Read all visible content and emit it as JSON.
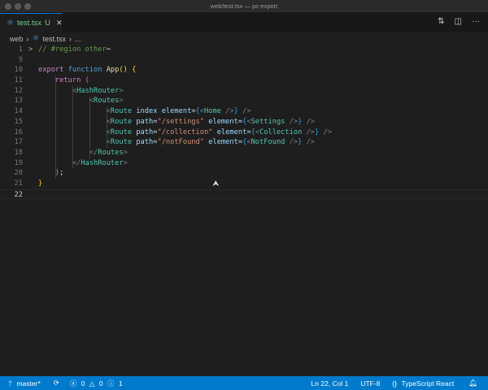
{
  "window": {
    "title": "web/test.tsx — ps-export"
  },
  "tab": {
    "name": "test.tsx",
    "status": "U",
    "close": "✕"
  },
  "breadcrumb": {
    "folder": "web",
    "file": "test.tsx",
    "more": "..."
  },
  "toolbar": {
    "compare": "⇅",
    "split": "◫",
    "more": "···"
  },
  "editor": {
    "lines": [
      {
        "n": "1",
        "fold": ">",
        "tokens": [
          [
            "// #region other",
            "cm"
          ],
          [
            "⋯",
            "pl"
          ]
        ]
      },
      {
        "n": "9",
        "tokens": []
      },
      {
        "n": "10",
        "tokens": [
          [
            "export ",
            "kw"
          ],
          [
            "function ",
            "fn"
          ],
          [
            "App",
            "nm"
          ],
          [
            "() ",
            "br"
          ],
          [
            "{",
            "br"
          ]
        ]
      },
      {
        "n": "11",
        "tokens": [
          [
            "    return ",
            "kw"
          ],
          [
            "(",
            "pr"
          ]
        ]
      },
      {
        "n": "12",
        "tokens": [
          [
            "        <",
            "an"
          ],
          [
            "HashRouter",
            "tg"
          ],
          [
            ">",
            "an"
          ]
        ]
      },
      {
        "n": "13",
        "tokens": [
          [
            "            <",
            "an"
          ],
          [
            "Routes",
            "tg"
          ],
          [
            ">",
            "an"
          ]
        ]
      },
      {
        "n": "14",
        "tokens": [
          [
            "                <",
            "an"
          ],
          [
            "Route ",
            "tg"
          ],
          [
            "index element",
            "at"
          ],
          [
            "=",
            "pl"
          ],
          [
            "{",
            "jb"
          ],
          [
            "<",
            "an"
          ],
          [
            "Home ",
            "tg"
          ],
          [
            "/>",
            "an"
          ],
          [
            "}",
            "jb"
          ],
          [
            " />",
            "an"
          ]
        ]
      },
      {
        "n": "15",
        "tokens": [
          [
            "                <",
            "an"
          ],
          [
            "Route ",
            "tg"
          ],
          [
            "path",
            "at"
          ],
          [
            "=",
            "pl"
          ],
          [
            "\"/settings\" ",
            "st"
          ],
          [
            "element",
            "at"
          ],
          [
            "=",
            "pl"
          ],
          [
            "{",
            "jb"
          ],
          [
            "<",
            "an"
          ],
          [
            "Settings ",
            "tg"
          ],
          [
            "/>",
            "an"
          ],
          [
            "}",
            "jb"
          ],
          [
            " />",
            "an"
          ]
        ]
      },
      {
        "n": "16",
        "tokens": [
          [
            "                <",
            "an"
          ],
          [
            "Route ",
            "tg"
          ],
          [
            "path",
            "at"
          ],
          [
            "=",
            "pl"
          ],
          [
            "\"/collection\" ",
            "st"
          ],
          [
            "element",
            "at"
          ],
          [
            "=",
            "pl"
          ],
          [
            "{",
            "jb"
          ],
          [
            "<",
            "an"
          ],
          [
            "Collection ",
            "tg"
          ],
          [
            "/>",
            "an"
          ],
          [
            "}",
            "jb"
          ],
          [
            " />",
            "an"
          ]
        ]
      },
      {
        "n": "17",
        "tokens": [
          [
            "                <",
            "an"
          ],
          [
            "Route ",
            "tg"
          ],
          [
            "path",
            "at"
          ],
          [
            "=",
            "pl"
          ],
          [
            "\"/notFound\" ",
            "st"
          ],
          [
            "element",
            "at"
          ],
          [
            "=",
            "pl"
          ],
          [
            "{",
            "jb"
          ],
          [
            "<",
            "an"
          ],
          [
            "NotFound ",
            "tg"
          ],
          [
            "/>",
            "an"
          ],
          [
            "}",
            "jb"
          ],
          [
            " />",
            "an"
          ]
        ]
      },
      {
        "n": "18",
        "tokens": [
          [
            "            </",
            "an"
          ],
          [
            "Routes",
            "tg"
          ],
          [
            ">",
            "an"
          ]
        ]
      },
      {
        "n": "19",
        "tokens": [
          [
            "        </",
            "an"
          ],
          [
            "HashRouter",
            "tg"
          ],
          [
            ">",
            "an"
          ]
        ]
      },
      {
        "n": "20",
        "tokens": [
          [
            "    ",
            "pl"
          ],
          [
            ")",
            "pr"
          ],
          [
            ";",
            "pl"
          ]
        ]
      },
      {
        "n": "21",
        "tokens": [
          [
            "}",
            "br"
          ]
        ]
      },
      {
        "n": "22",
        "current": true,
        "tokens": []
      }
    ]
  },
  "status": {
    "branch": "master*",
    "errors": "0",
    "warnings": "0",
    "info": "1",
    "position": "Ln 22, Col 1",
    "encoding": "UTF-8",
    "language": "TypeScript React"
  }
}
